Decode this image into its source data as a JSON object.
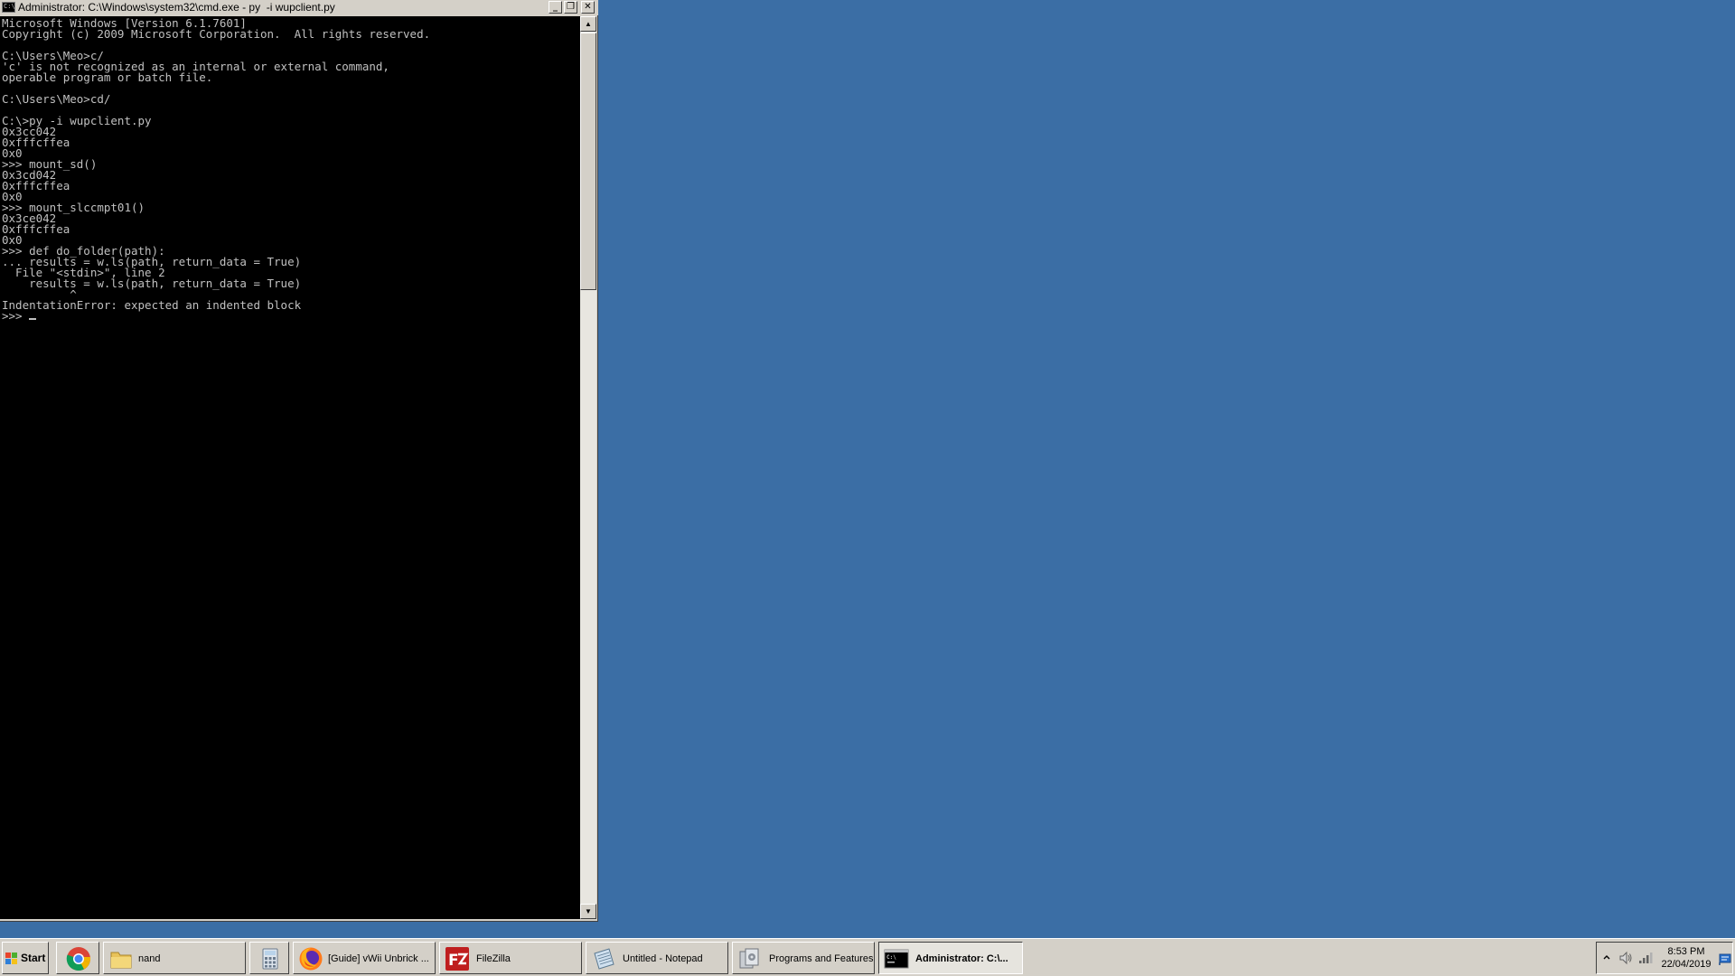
{
  "window": {
    "title": "Administrator: C:\\Windows\\system32\\cmd.exe - py  -i wupclient.py",
    "icon": "cmd-console-icon",
    "controls": {
      "minimize": "_",
      "restore": "❐",
      "close": "✕"
    }
  },
  "console": {
    "text": "Microsoft Windows [Version 6.1.7601]\nCopyright (c) 2009 Microsoft Corporation.  All rights reserved.\n\nC:\\Users\\Meo>c/\n'c' is not recognized as an internal or external command,\noperable program or batch file.\n\nC:\\Users\\Meo>cd/\n\nC:\\>py -i wupclient.py\n0x3cc042\n0xfffcffea\n0x0\n>>> mount_sd()\n0x3cd042\n0xfffcffea\n0x0\n>>> mount_slccmpt01()\n0x3ce042\n0xfffcffea\n0x0\n>>> def do_folder(path):\n... results = w.ls(path, return_data = True)\n  File \"<stdin>\", line 2\n    results = w.ls(path, return_data = True)\n          ^\nIndentationError: expected an indented block\n>>> ",
    "text_color": "#c0c0c0",
    "background": "#000000"
  },
  "scrollbar": {
    "up_arrow": "▲",
    "down_arrow": "▼"
  },
  "desktop": {
    "background": "#3b6ea5"
  },
  "taskbar": {
    "start_label": "Start",
    "tasks": [
      {
        "label": "",
        "icon": "chrome-icon"
      },
      {
        "label": "nand",
        "icon": "folder-icon"
      },
      {
        "label": "",
        "icon": "calculator-icon"
      },
      {
        "label": "[Guide] vWii Unbrick ...",
        "icon": "firefox-icon"
      },
      {
        "label": "FileZilla",
        "icon": "filezilla-icon"
      },
      {
        "label": "Untitled - Notepad",
        "icon": "notepad-icon"
      },
      {
        "label": "Programs and Features",
        "icon": "programs-features-icon"
      },
      {
        "label": "Administrator: C:\\...",
        "icon": "cmd-icon",
        "active": true
      }
    ],
    "tray": {
      "time": "8:53 PM",
      "date": "22/04/2019",
      "icons": [
        "show-hidden-icons-arrow",
        "volume-icon",
        "network-icon",
        "action-center-flag-icon"
      ]
    }
  }
}
